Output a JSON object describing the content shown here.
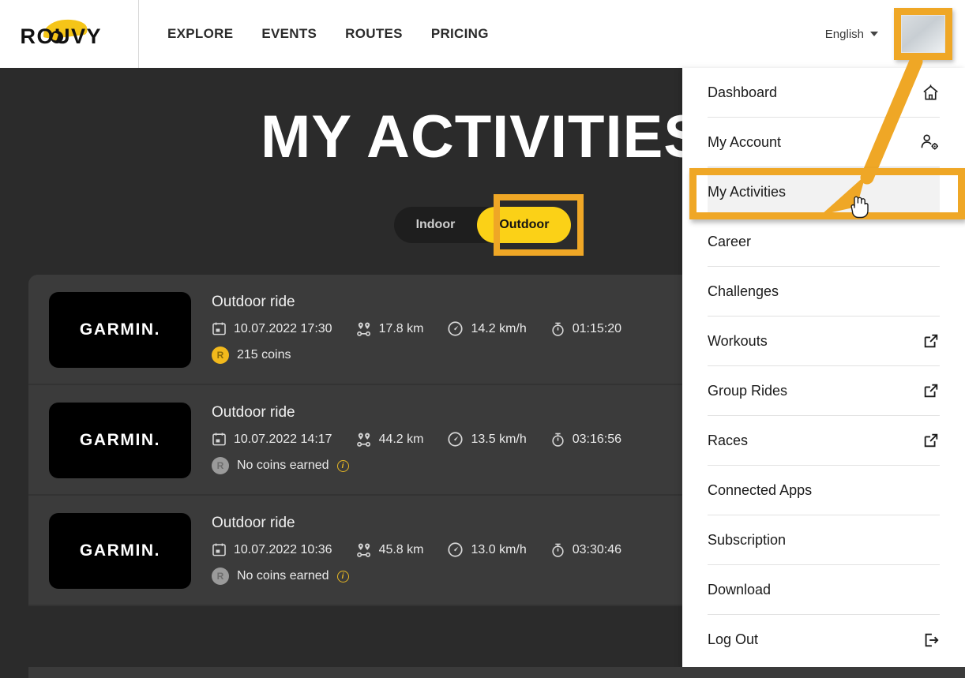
{
  "header": {
    "logo_text": "ROUVY",
    "nav": [
      {
        "label": "EXPLORE"
      },
      {
        "label": "EVENTS"
      },
      {
        "label": "ROUTES"
      },
      {
        "label": "PRICING"
      }
    ],
    "language": "English"
  },
  "page": {
    "title": "MY ACTIVITIES",
    "toggle": {
      "options": [
        {
          "label": "Indoor",
          "active": false
        },
        {
          "label": "Outdoor",
          "active": true
        }
      ]
    }
  },
  "activities": [
    {
      "thumb_label": "GARMIN.",
      "title": "Outdoor ride",
      "datetime": "10.07.2022 17:30",
      "distance": "17.8 km",
      "speed": "14.2 km/h",
      "duration": "01:15:20",
      "coins": "215 coins",
      "coins_earned": true,
      "coin_badge_letter": "R"
    },
    {
      "thumb_label": "GARMIN.",
      "title": "Outdoor ride",
      "datetime": "10.07.2022 14:17",
      "distance": "44.2 km",
      "speed": "13.5 km/h",
      "duration": "03:16:56",
      "coins": "No coins earned",
      "coins_earned": false,
      "coin_badge_letter": "R",
      "info_glyph": "i"
    },
    {
      "thumb_label": "GARMIN.",
      "title": "Outdoor ride",
      "datetime": "10.07.2022 10:36",
      "distance": "45.8 km",
      "speed": "13.0 km/h",
      "duration": "03:30:46",
      "coins": "No coins earned",
      "coins_earned": false,
      "coin_badge_letter": "R",
      "info_glyph": "i"
    }
  ],
  "menu": {
    "items": [
      {
        "label": "Dashboard",
        "icon": "home-icon",
        "selected": false
      },
      {
        "label": "My Account",
        "icon": "user-settings-icon",
        "selected": false
      },
      {
        "label": "My Activities",
        "icon": "none",
        "selected": true
      },
      {
        "label": "Career",
        "icon": "none",
        "selected": false
      },
      {
        "label": "Challenges",
        "icon": "none",
        "selected": false
      },
      {
        "label": "Workouts",
        "icon": "external-link-icon",
        "selected": false
      },
      {
        "label": "Group Rides",
        "icon": "external-link-icon",
        "selected": false
      },
      {
        "label": "Races",
        "icon": "external-link-icon",
        "selected": false
      },
      {
        "label": "Connected Apps",
        "icon": "none",
        "selected": false
      },
      {
        "label": "Subscription",
        "icon": "none",
        "selected": false
      },
      {
        "label": "Download",
        "icon": "none",
        "selected": false
      },
      {
        "label": "Log Out",
        "icon": "logout-icon",
        "selected": false
      }
    ]
  },
  "colors": {
    "brand_yellow": "#fbd117",
    "annotation_orange": "#efa726",
    "page_background": "#2b2b2b",
    "card_background": "#3b3b3b",
    "header_background": "#ffffff"
  }
}
